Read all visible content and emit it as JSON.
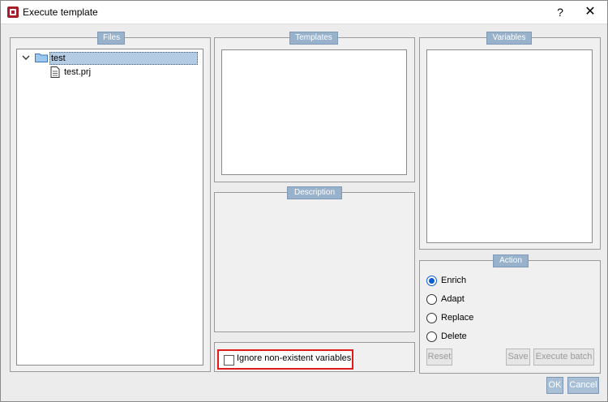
{
  "window": {
    "title": "Execute template",
    "help": "?",
    "close": "✕"
  },
  "files": {
    "legend": "Files",
    "tree": {
      "root": "test",
      "child": "test.prj"
    }
  },
  "templates": {
    "legend": "Templates"
  },
  "description": {
    "legend": "Description"
  },
  "variables": {
    "legend": "Variables"
  },
  "ignore": {
    "label": "Ignore non-existent variables",
    "checked": false
  },
  "action": {
    "legend": "Action",
    "options": [
      {
        "label": "Enrich",
        "selected": true
      },
      {
        "label": "Adapt",
        "selected": false
      },
      {
        "label": "Replace",
        "selected": false
      },
      {
        "label": "Delete",
        "selected": false
      }
    ],
    "buttons": {
      "reset": "Reset",
      "save": "Save",
      "execute": "Execute batch"
    }
  },
  "footer": {
    "ok": "OK",
    "cancel": "Cancel"
  },
  "colors": {
    "legend_bg": "#98b2cc",
    "selection": "#b5cde4",
    "highlight": "#e01b1b",
    "radio_on": "#0b5bd3"
  }
}
